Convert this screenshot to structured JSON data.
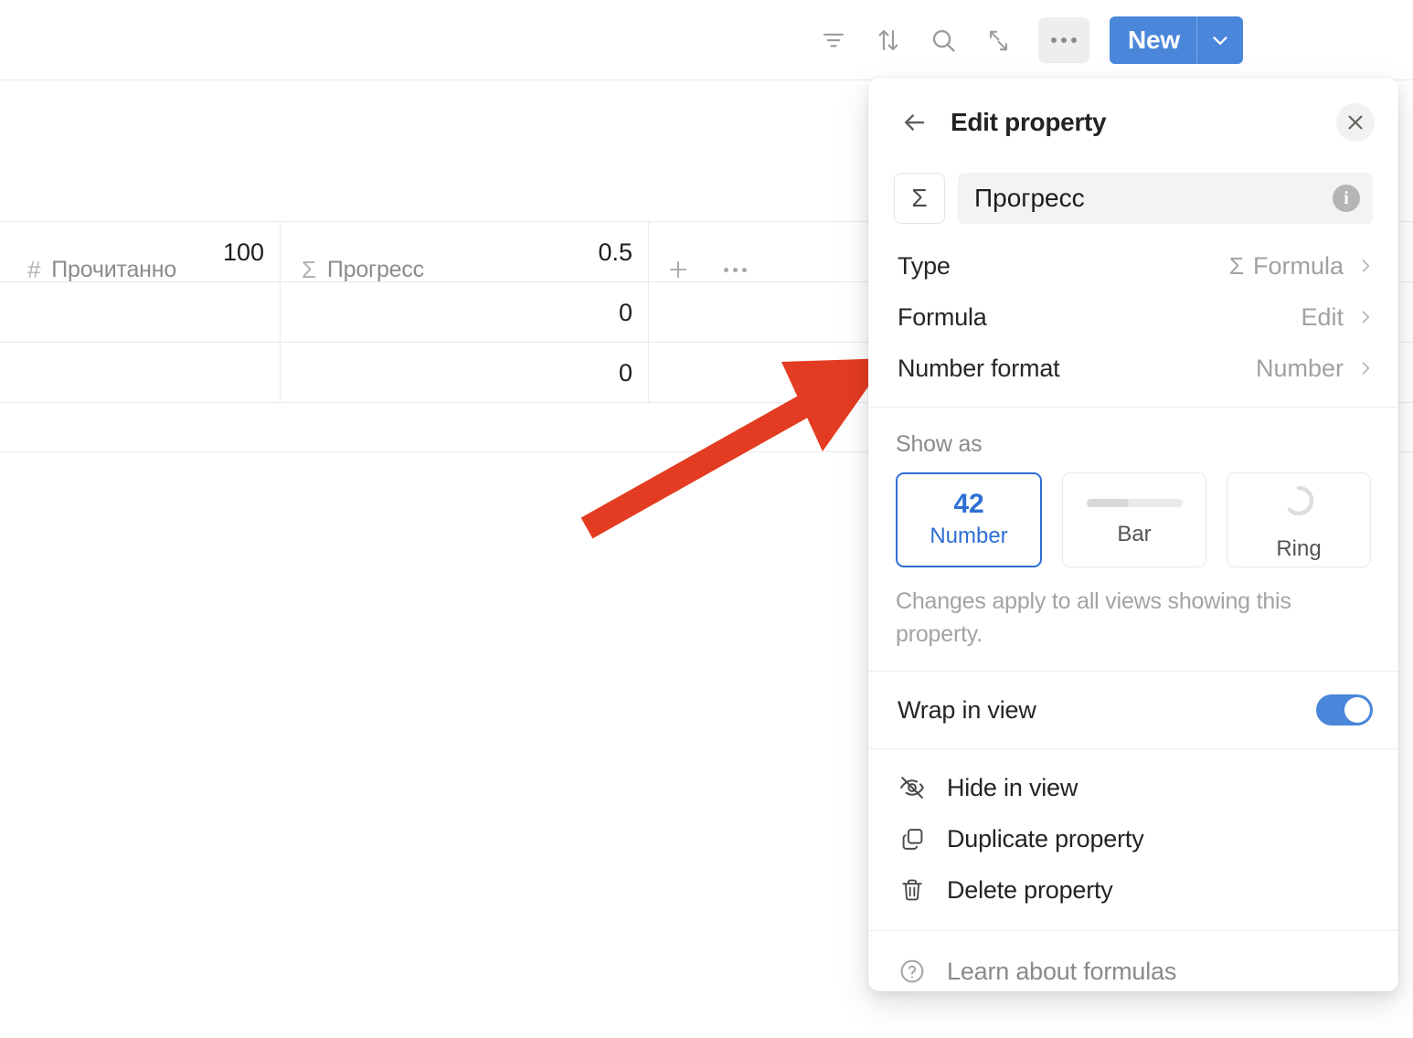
{
  "toolbar": {
    "icons": [
      {
        "name": "filter-icon",
        "label": "Filter"
      },
      {
        "name": "sort-icon",
        "label": "Sort"
      },
      {
        "name": "search-icon",
        "label": "Search"
      },
      {
        "name": "expand-icon",
        "label": "Expand"
      },
      {
        "name": "more-options-icon",
        "label": "More options"
      }
    ],
    "new_button": {
      "label": "New",
      "caret": "chevron-down-icon",
      "color": "#4a86da"
    }
  },
  "table": {
    "columns": [
      {
        "glyph": "#",
        "label": "Прочитанно"
      },
      {
        "glyph": "Σ",
        "label": "Прогресс"
      }
    ],
    "rows": [
      {
        "read": "100",
        "progress": "0.5"
      },
      {
        "read": "",
        "progress": "0"
      },
      {
        "read": "",
        "progress": "0"
      }
    ],
    "add_column_label": "+",
    "row_options_label": "..."
  },
  "panel": {
    "back_icon": "arrow-left-icon",
    "title": "Edit property",
    "close_icon": "close-icon",
    "property": {
      "type_glyph": "Σ",
      "name": "Прогресс",
      "info_icon": "info-icon"
    },
    "options": [
      {
        "key": "Type",
        "value": "Formula",
        "glyph": "Σ"
      },
      {
        "key": "Formula",
        "value": "Edit",
        "glyph": ""
      },
      {
        "key": "Number format",
        "value": "Number",
        "glyph": ""
      }
    ],
    "show_as": {
      "label": "Show as",
      "cards": [
        {
          "id": "number",
          "sample": "42",
          "caption": "Number",
          "selected": true
        },
        {
          "id": "bar",
          "sample": "",
          "caption": "Bar",
          "selected": false
        },
        {
          "id": "ring",
          "sample": "",
          "caption": "Ring",
          "selected": false
        }
      ],
      "note": "Changes apply to all views showing this property."
    },
    "wrap_in_view": {
      "label": "Wrap in view",
      "enabled": true
    },
    "menu": [
      {
        "icon": "eye-off-icon",
        "label": "Hide in view"
      },
      {
        "icon": "duplicate-icon",
        "label": "Duplicate property"
      },
      {
        "icon": "trash-icon",
        "label": "Delete property"
      }
    ],
    "footer": {
      "icon": "question-circle-icon",
      "label": "Learn about formulas"
    }
  },
  "annotation": {
    "arrow_color": "#e43c22",
    "name": "red-arrow-pointing-to-number-format"
  },
  "colors": {
    "accent": "#4a86da",
    "selected_border": "#2e6fd4",
    "grid": "#eceaea"
  }
}
